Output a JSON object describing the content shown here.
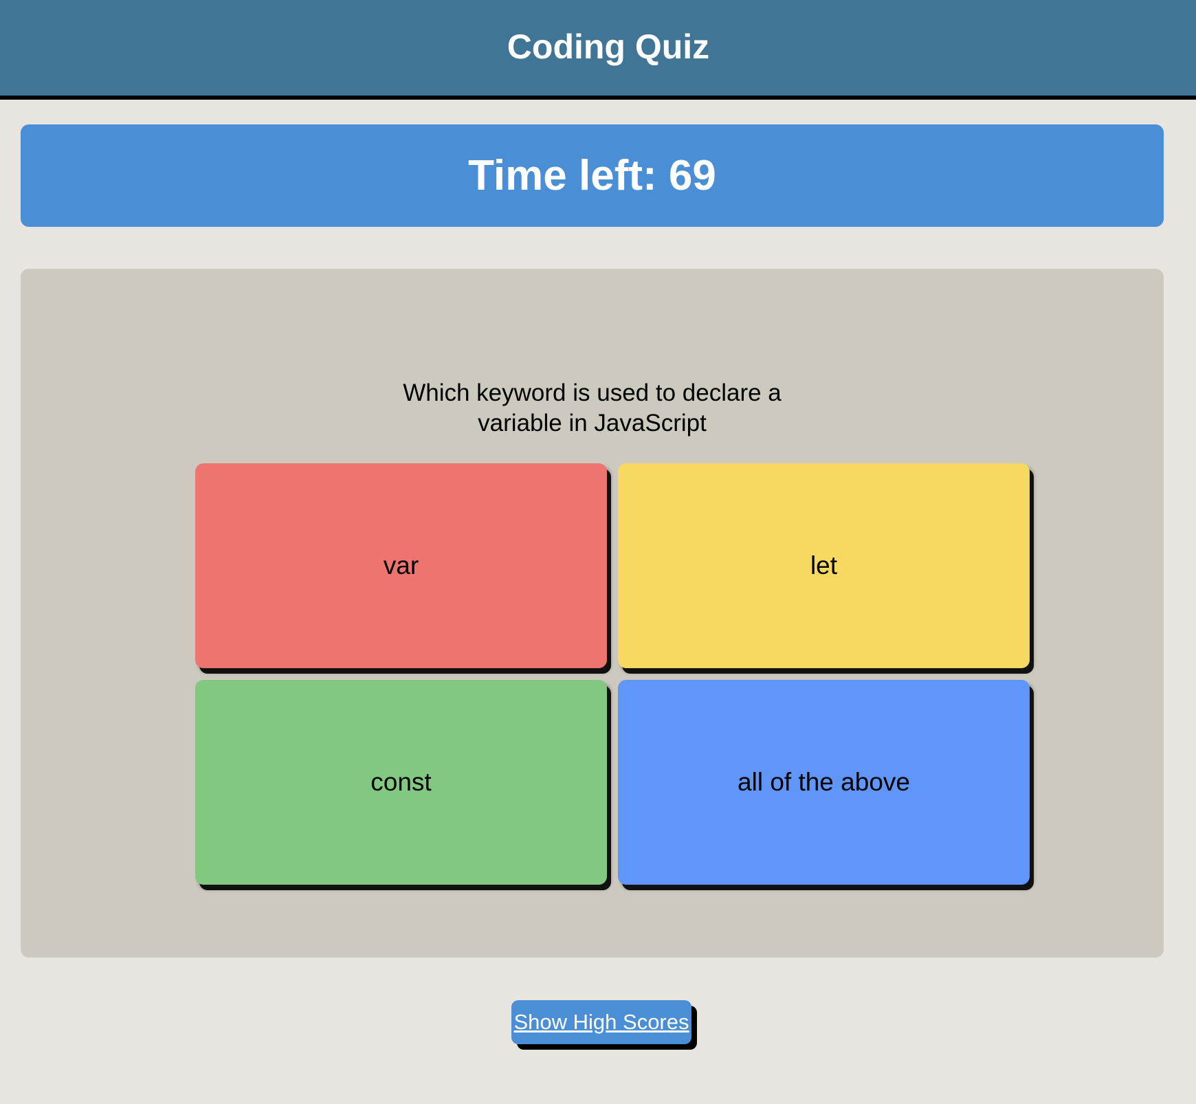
{
  "header": {
    "title": "Coding Quiz"
  },
  "timer": {
    "label": "Time left: 69",
    "seconds": 69
  },
  "quiz": {
    "question": "Which keyword is used to declare a variable in JavaScript",
    "answers": [
      {
        "label": "var",
        "color": "#ee7470"
      },
      {
        "label": "let",
        "color": "#f7d860"
      },
      {
        "label": "const",
        "color": "#83c881"
      },
      {
        "label": "all of the above",
        "color": "#6096fa"
      }
    ]
  },
  "footer": {
    "high_scores_label": "Show High Scores"
  },
  "colors": {
    "header_bg": "#407595",
    "timer_bg": "#4a8fd5",
    "page_bg": "#e8e4df",
    "panel_bg": "#cdc9bf"
  }
}
